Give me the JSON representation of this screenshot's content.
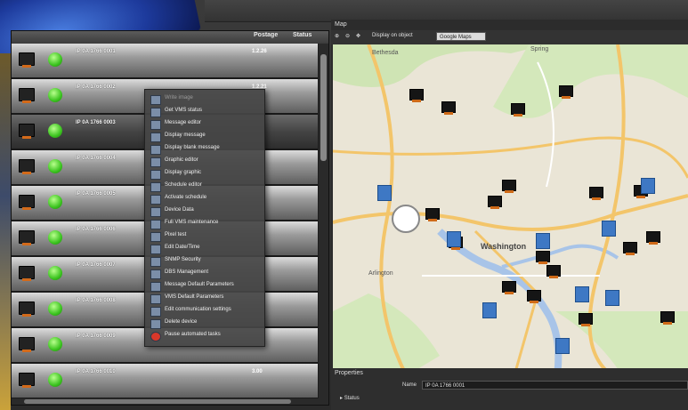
{
  "table": {
    "columns": [
      "Postage",
      "Status"
    ],
    "rows": [
      {
        "addr": "IP 0A 1766 0001",
        "ip": "1.2.26"
      },
      {
        "addr": "IP 0A 1766 0002",
        "ip": "1.2.21"
      },
      {
        "addr": "IP 0A 1766 0003",
        "ip": ""
      },
      {
        "addr": "IP 0A 1766 0004",
        "ip": ""
      },
      {
        "addr": "IP 0A 1766 0005",
        "ip": ""
      },
      {
        "addr": "IP 0A 1766 0006",
        "ip": ""
      },
      {
        "addr": "IP 0A 1766 0007",
        "ip": ""
      },
      {
        "addr": "IP 0A 1766 0008",
        "ip": ""
      },
      {
        "addr": "IP 0A 1766 0009",
        "ip": ""
      },
      {
        "addr": "IP 0A 1766 0010",
        "ip": "3.00"
      }
    ]
  },
  "context_menu": {
    "items": [
      {
        "label": "Write image",
        "disabled": true
      },
      {
        "label": "Get VMS status"
      },
      {
        "label": "Message editor"
      },
      {
        "label": "Display message"
      },
      {
        "label": "Display blank message"
      },
      {
        "label": "Graphic editor"
      },
      {
        "label": "Display graphic"
      },
      {
        "label": "Schedule editor"
      },
      {
        "label": "Activate schedule"
      },
      {
        "label": "Device Data"
      },
      {
        "label": "Full VMS maintenance"
      },
      {
        "label": "Pixel test"
      },
      {
        "label": "Edit Date/Time"
      },
      {
        "label": "SNMP Security"
      },
      {
        "label": "DBS Management"
      },
      {
        "label": "Message Default Parameters"
      },
      {
        "label": "VMS Default Parameters"
      },
      {
        "label": "Edit communication settings"
      },
      {
        "label": "Delete device"
      },
      {
        "label": "Pause automated tasks"
      }
    ]
  },
  "map": {
    "title": "Map",
    "toolbar": {
      "btn1": "Display on object",
      "select": "Google Maps"
    },
    "labels": {
      "washington": "Washington",
      "arlington": "Arlington",
      "bethesda": "Bethesda",
      "spring": "Spring"
    }
  },
  "properties": {
    "title": "Properties",
    "name_label": "Name",
    "name_value": "IP 0A 1766 0001",
    "status_label": "Status"
  }
}
